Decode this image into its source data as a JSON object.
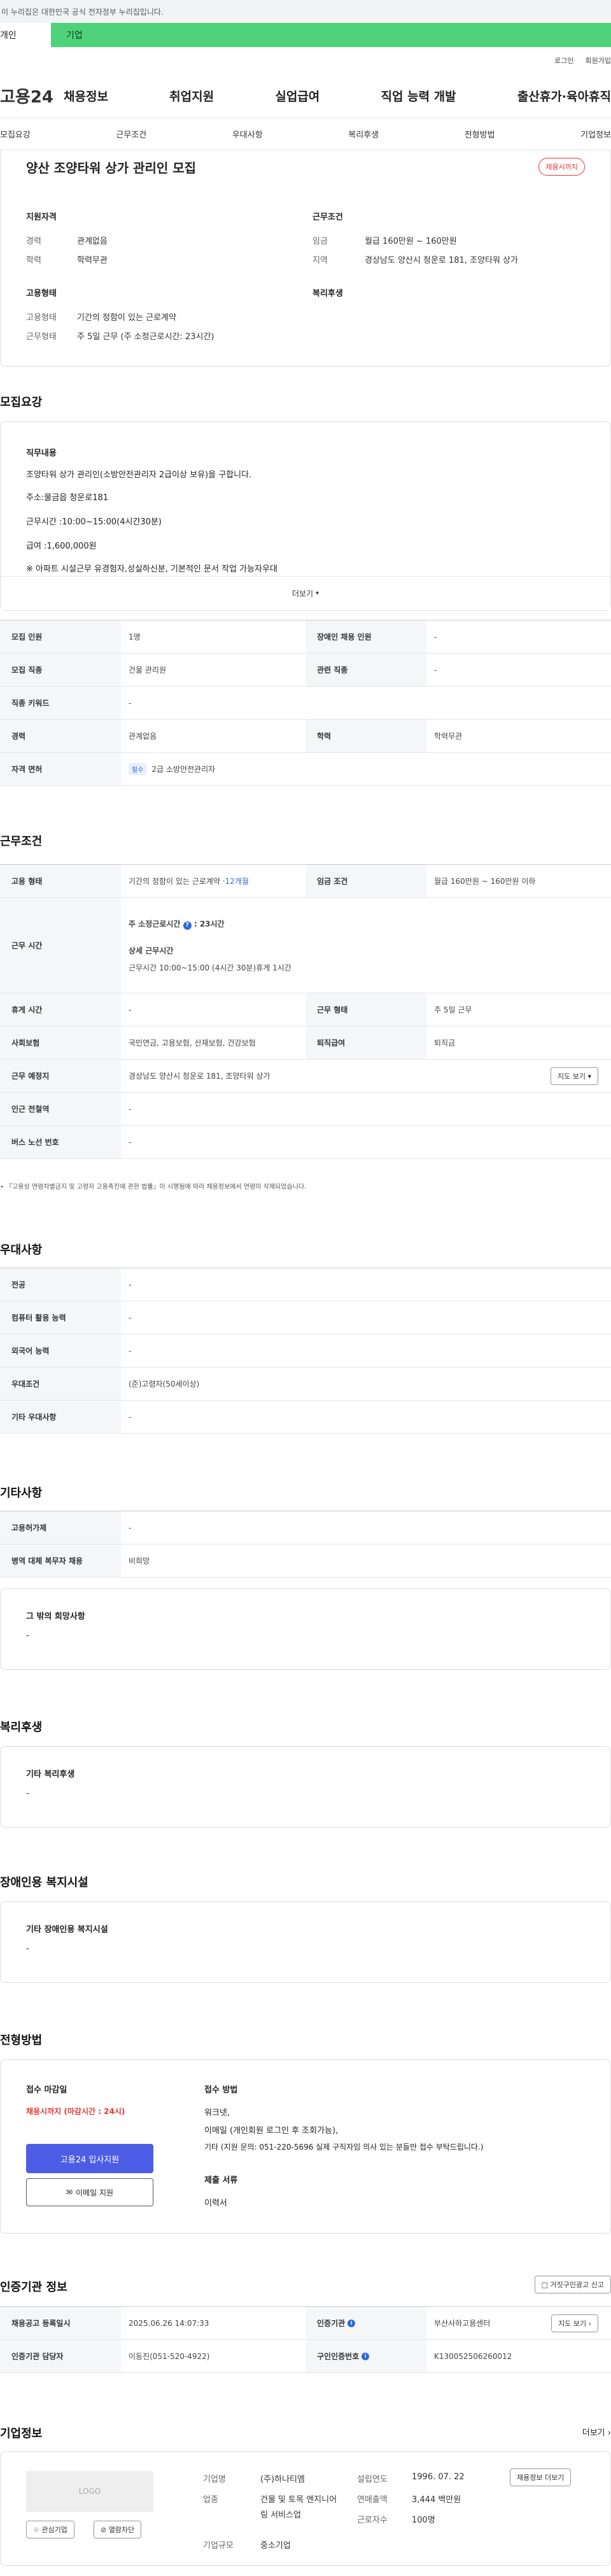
{
  "banner": "이 누리집은 대한민국 공식 전자정부 누리집입니다.",
  "usertabs": {
    "person": "개인",
    "corp": "기업"
  },
  "util": {
    "login": "로그인",
    "join": "회원가입"
  },
  "logo": "고용24",
  "gnb": [
    "채용정보",
    "취업지원",
    "실업급여",
    "직업 능력 개발",
    "출산휴가·육아휴직"
  ],
  "subtabs": [
    "모집요강",
    "근무조건",
    "우대사항",
    "복리후생",
    "전형방법",
    "기업정보"
  ],
  "job": {
    "title": "양산 조양타워 상가 관리인 모집",
    "status": "채용시까지",
    "qual_title": "지원자격",
    "cond_title": "근무조건",
    "emp_title": "고용형태",
    "welfare_title": "복리후생",
    "career_lbl": "경력",
    "career": "관계없음",
    "edu_lbl": "학력",
    "edu": "학력무관",
    "pay_lbl": "임금",
    "pay": "월급 160만원 ~ 160만원",
    "loc_lbl": "지역",
    "loc": "경상남도 양산시 청운로 181, 조양타워 상가",
    "type_lbl": "고용형태",
    "type": "기간의 정함이 있는 근로계약",
    "hours_lbl": "근무형태",
    "hours": "주 5일 근무 (주 소정근로시간: 23시간)"
  },
  "recruit": {
    "title": "모집요강",
    "duty_title": "직무내용",
    "lines": [
      "조양타워 상가 관리인(소방안전관리자 2급이상 보유)을 구합니다.",
      "주소:물금읍 청운로181",
      "근무시간 :10:00~15:00(4시간30분)",
      "급여 :1,600,000원",
      "※ 아파트 시설근무 유경험자,성실하신분, 기본적인 문서 작업 가능자우대"
    ],
    "more": "더보기",
    "rows": [
      [
        "모집 인원",
        "1명",
        "장애인 채용 인원",
        "-"
      ],
      [
        "모집 직종",
        "건물 관리원",
        "관련 직종",
        "-"
      ]
    ],
    "keyword_lbl": "직종 키워드",
    "keyword": "-",
    "career_lbl": "경력",
    "career": "관계없음",
    "edu_lbl": "학력",
    "edu": "학력무관",
    "license_lbl": "자격 면허",
    "license_tag": "필수",
    "license": "2급 소방안전관리자"
  },
  "work": {
    "title": "근무조건",
    "type_lbl": "고용 형태",
    "type": "기간의 정함이 있는 근로계약 · ",
    "type_months": "12개월",
    "pay_lbl": "임금 조건",
    "pay": "월급 160만원 ~ 160만원 이하",
    "time_lbl": "근무 시간",
    "weekly": "주 소정근로시간",
    "weekly_val": "23시간",
    "detail_title": "상세 근무시간",
    "detail": "근무시간 10:00~15:00 (4시간 30분)휴게 1시간",
    "rest_lbl": "휴게 시간",
    "rest": "-",
    "form_lbl": "근무 형태",
    "form": "주 5일 근무",
    "ins_lbl": "사회보험",
    "ins": "국민연금, 고용보험, 산재보험, 건강보험",
    "sev_lbl": "퇴직급여",
    "sev": "퇴직금",
    "place_lbl": "근무 예정지",
    "place": "경상남도 양산시 청운로 181, 조양타워 상가",
    "map": "지도 보기",
    "station_lbl": "인근 전철역",
    "station": "-",
    "bus_lbl": "버스 노선 번호",
    "bus": "-",
    "note": "『고용상 연령차별금지 및 고령자 고용촉진에 관한 법률』이 시행됨에 따라 채용정보에서 연령이 삭제되었습니다."
  },
  "pref": {
    "title": "우대사항",
    "rows": [
      [
        "전공",
        "-"
      ],
      [
        "컴퓨터 활용 능력",
        "-"
      ],
      [
        "외국어 능력",
        "-"
      ],
      [
        "우대조건",
        "(준)고령자(50세이상)"
      ],
      [
        "기타 우대사항",
        "-"
      ]
    ]
  },
  "etc": {
    "title": "기타사항",
    "rows": [
      [
        "고용허가제",
        "-"
      ],
      [
        "병역 대체 복무자 채용",
        "비희망"
      ]
    ],
    "wish_title": "그 밖의 희망사항",
    "wish": "-"
  },
  "welfare": {
    "title": "복리후생",
    "sub": "기타 복리후생",
    "val": "-"
  },
  "facility": {
    "title": "장애인용 복지시설",
    "sub": "기타 장애인용 복지시설",
    "val": "-"
  },
  "screening": {
    "title": "전형방법",
    "deadline_lbl": "접수 마감일",
    "deadline": "채용시까지 (마감시간 : 24시)",
    "apply": "고용24 입사지원",
    "email": "이메일 지원",
    "method_lbl": "접수 방법",
    "method": [
      "워크넷,",
      "이메일 (개인회원 로그인 후 조회가능),",
      "기타 (지원 문의: 051-220-5696 실제 구직자임 의사 있는 분들만 접수 부탁드립니다.)"
    ],
    "docs_lbl": "제출 서류",
    "docs": "이력서"
  },
  "cert": {
    "title": "인증기관 정보",
    "report": "거짓구인광고 신고",
    "reg_lbl": "채용공고 등록일시",
    "reg": "2025.06.26 14:07:33",
    "org_lbl": "인증기관",
    "org": "부산사하고용센터",
    "map": "지도 보기",
    "mgr_lbl": "인증기관 담당자",
    "mgr": "이동진(051-520-4922)",
    "no_lbl": "구인인증번호",
    "no": "K130052506260012"
  },
  "company": {
    "title": "기업정보",
    "more": "더보기",
    "logo": "LOGO",
    "fav": "관심기업",
    "block": "열람차단",
    "name_lbl": "기업명",
    "name": "(주)하나티엠",
    "ind_lbl": "업종",
    "ind": "건물 및 토목 엔지니어링 서비스업",
    "size_lbl": "기업규모",
    "size": "중소기업",
    "est_lbl": "설립연도",
    "est": "1996. 07. 22",
    "sales_lbl": "연매출액",
    "sales": "3,444 백만원",
    "emp_lbl": "근로자수",
    "emp": "100명",
    "jobs": "채용정보 더보기"
  }
}
